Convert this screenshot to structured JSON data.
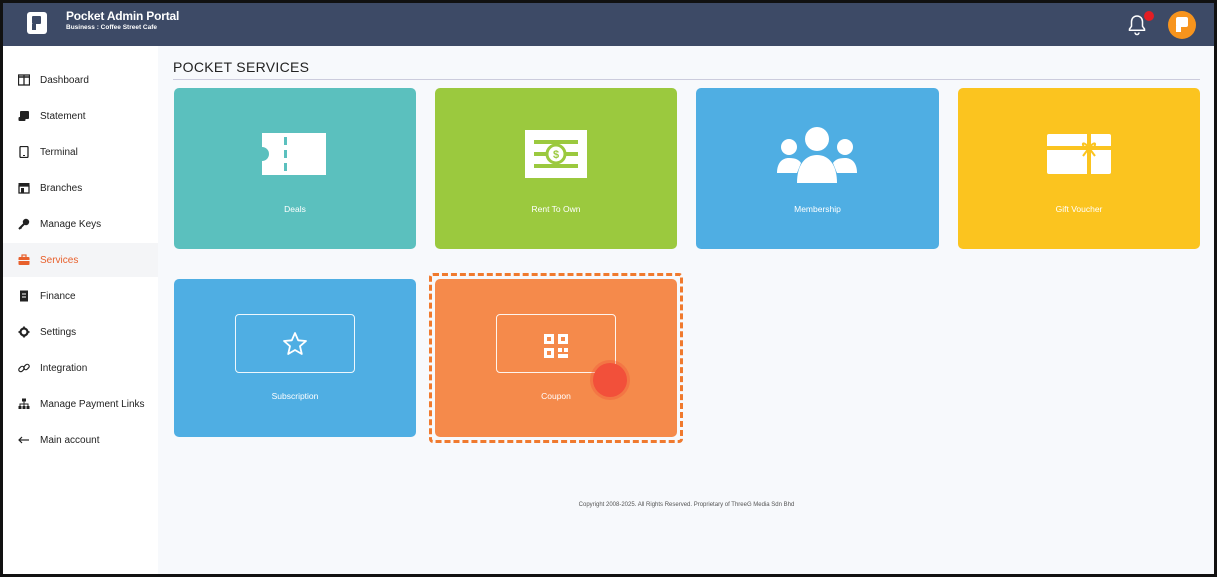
{
  "header": {
    "app_title": "Pocket Admin Portal",
    "business_line": "Business : Coffee Street Cafe"
  },
  "sidebar": {
    "items": [
      {
        "label": "Dashboard",
        "icon": "columns-icon"
      },
      {
        "label": "Statement",
        "icon": "scroll-icon"
      },
      {
        "label": "Terminal",
        "icon": "tablet-icon"
      },
      {
        "label": "Branches",
        "icon": "store-icon"
      },
      {
        "label": "Manage Keys",
        "icon": "key-icon"
      },
      {
        "label": "Services",
        "icon": "toolbox-icon",
        "active": true
      },
      {
        "label": "Finance",
        "icon": "receipt-icon"
      },
      {
        "label": "Settings",
        "icon": "gear-icon"
      },
      {
        "label": "Integration",
        "icon": "link-icon"
      },
      {
        "label": "Manage Payment Links",
        "icon": "sitemap-icon"
      },
      {
        "label": "Main account",
        "icon": "arrow-left-icon"
      }
    ],
    "active_color": "#e8602c"
  },
  "main": {
    "title": "POCKET SERVICES",
    "cards": [
      {
        "label": "Deals",
        "color": "#5bc0be",
        "icon": "ticket-icon"
      },
      {
        "label": "Rent To Own",
        "color": "#9bc93e",
        "icon": "money-icon"
      },
      {
        "label": "Membership",
        "color": "#4faee3",
        "icon": "users-icon"
      },
      {
        "label": "Gift Voucher",
        "color": "#fbc41f",
        "icon": "gift-card-icon"
      },
      {
        "label": "Subscription",
        "color": "#4faee3",
        "icon": "star-icon"
      },
      {
        "label": "Coupon",
        "color": "#f58a4b",
        "icon": "qr-icon"
      }
    ]
  },
  "footer": {
    "copyright": "Copyright 2008-2025. All Rights Reserved. Proprietary of ThreeG Media Sdn Bhd"
  },
  "colors": {
    "header_bg": "#3d4a66",
    "notification": "#e31e24",
    "highlight": "#f07a2e"
  }
}
